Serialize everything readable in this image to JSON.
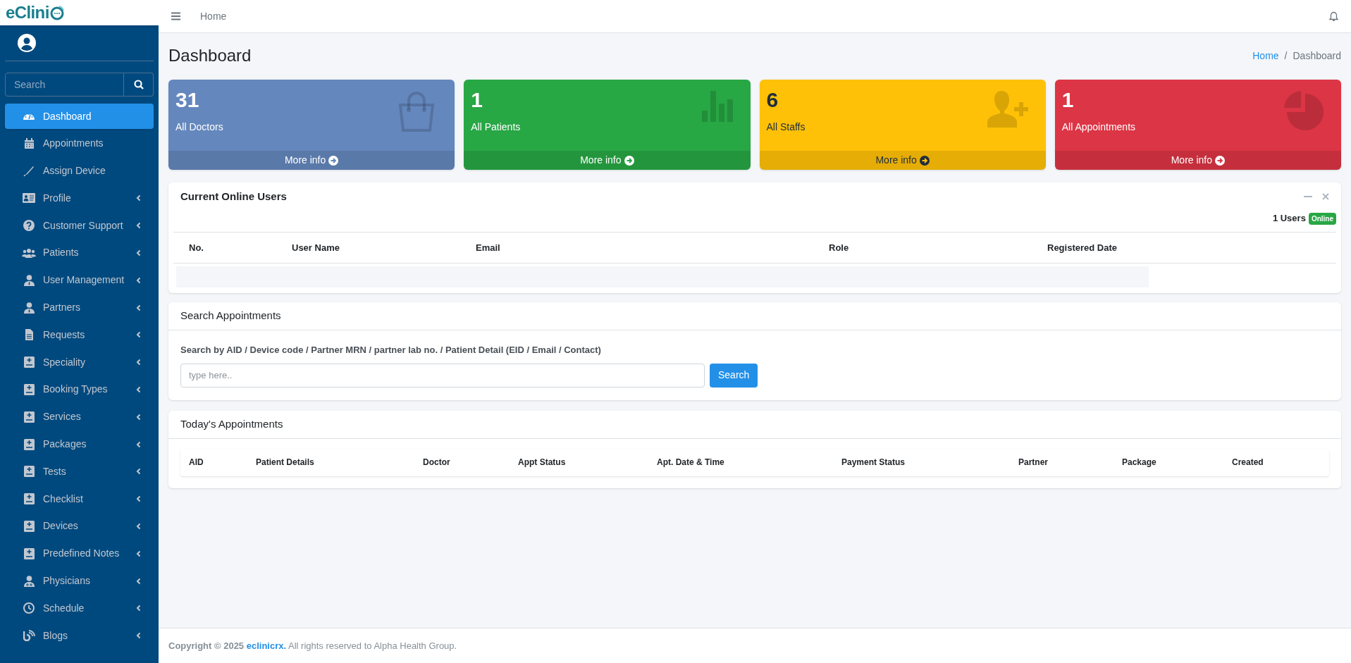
{
  "logo": {
    "text": "eClini"
  },
  "sidebar": {
    "search": {
      "placeholder": "Search"
    },
    "items": [
      {
        "label": "Dashboard",
        "selected": true,
        "expandable": false
      },
      {
        "label": "Appointments",
        "selected": false,
        "expandable": false
      },
      {
        "label": "Assign Device",
        "selected": false,
        "expandable": false
      },
      {
        "label": "Profile",
        "selected": false,
        "expandable": true
      },
      {
        "label": "Customer Support",
        "selected": false,
        "expandable": true
      },
      {
        "label": "Patients",
        "selected": false,
        "expandable": true
      },
      {
        "label": "User Management",
        "selected": false,
        "expandable": true
      },
      {
        "label": "Partners",
        "selected": false,
        "expandable": true
      },
      {
        "label": "Requests",
        "selected": false,
        "expandable": true
      },
      {
        "label": "Speciality",
        "selected": false,
        "expandable": true
      },
      {
        "label": "Booking Types",
        "selected": false,
        "expandable": true
      },
      {
        "label": "Services",
        "selected": false,
        "expandable": true
      },
      {
        "label": "Packages",
        "selected": false,
        "expandable": true
      },
      {
        "label": "Tests",
        "selected": false,
        "expandable": true
      },
      {
        "label": "Checklist",
        "selected": false,
        "expandable": true
      },
      {
        "label": "Devices",
        "selected": false,
        "expandable": true
      },
      {
        "label": "Predefined Notes",
        "selected": false,
        "expandable": true
      },
      {
        "label": "Physicians",
        "selected": false,
        "expandable": true
      },
      {
        "label": "Schedule",
        "selected": false,
        "expandable": true
      },
      {
        "label": "Blogs",
        "selected": false,
        "expandable": true
      }
    ]
  },
  "topbar": {
    "link": "Home"
  },
  "page": {
    "title": "Dashboard",
    "breadcrumb": [
      {
        "label": "Home",
        "selected": false
      },
      {
        "label": "Dashboard",
        "selected": true
      }
    ],
    "breadcrumb_separator": "/"
  },
  "cards": [
    {
      "value": "31",
      "label": "All Doctors",
      "footer": "More info",
      "color": "#6487bd"
    },
    {
      "value": "1",
      "label": "All Patients",
      "footer": "More info",
      "color": "#28a745"
    },
    {
      "value": "6",
      "label": "All Staffs",
      "footer": "More info",
      "color": "#ffc107"
    },
    {
      "value": "1",
      "label": "All Appointments",
      "footer": "More info",
      "color": "#dc3545"
    }
  ],
  "online_users": {
    "title": "Current Online Users",
    "count": "1 Users",
    "badge": "Online",
    "columns": [
      "No.",
      "User Name",
      "Email",
      "Role",
      "Registered Date"
    ]
  },
  "search_appointments": {
    "title": "Search Appointments",
    "label": "Search by AID / Device code / Partner MRN / partner lab no. / Patient Detail (EID / Email / Contact)",
    "placeholder": "type here..",
    "button": "Search"
  },
  "todays_appointments": {
    "title": "Today's Appointments",
    "columns": [
      "AID",
      "Patient Details",
      "Doctor",
      "Appt Status",
      "Apt. Date & Time",
      "Payment Status",
      "Partner",
      "Package",
      "Created"
    ]
  },
  "footer": {
    "prefix": "Copyright © 2025",
    "link": "eclinicrx.",
    "suffix": "All rights reserved to Alpha Health Group."
  }
}
